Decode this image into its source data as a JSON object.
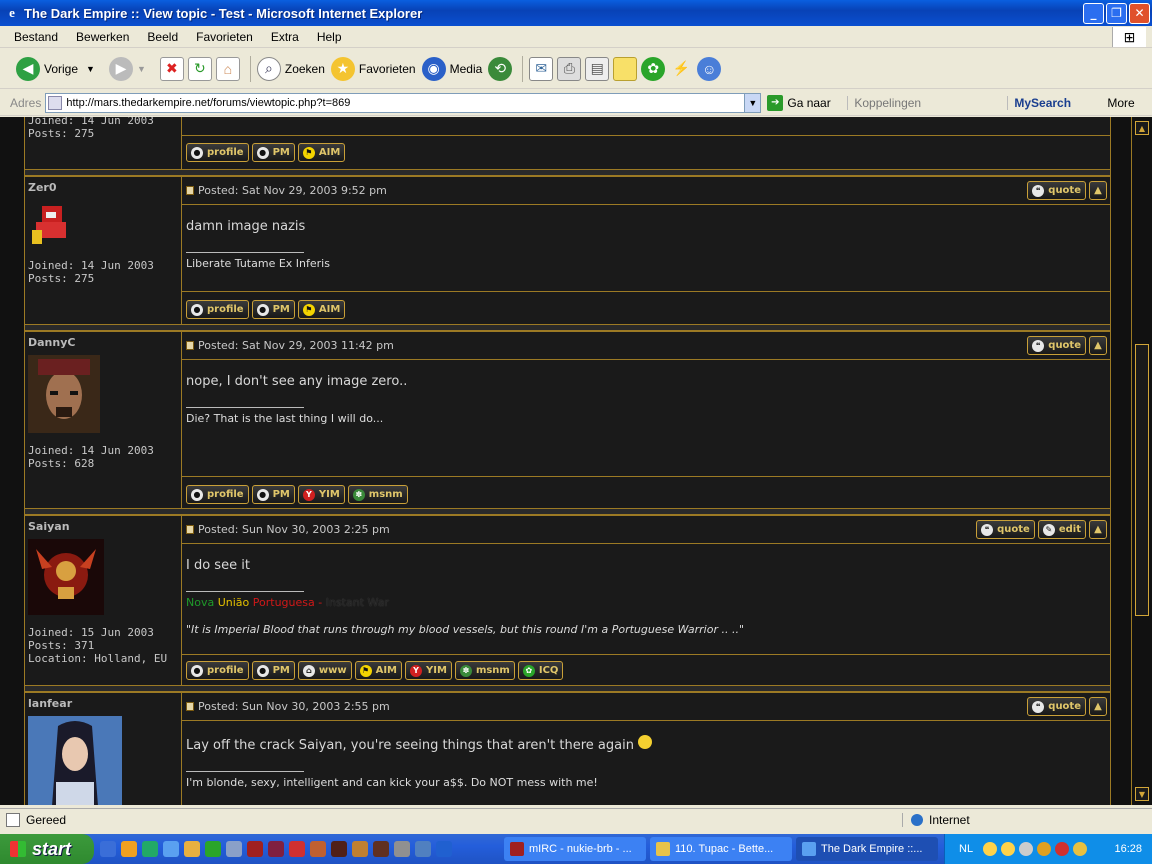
{
  "window": {
    "title": "The Dark Empire :: View topic - Test - Microsoft Internet Explorer"
  },
  "menu": [
    "Bestand",
    "Bewerken",
    "Beeld",
    "Favorieten",
    "Extra",
    "Help"
  ],
  "toolbar": {
    "back": "Vorige",
    "search": "Zoeken",
    "favorites": "Favorieten",
    "media": "Media"
  },
  "address": {
    "label": "Adres",
    "url": "http://mars.thedarkempire.net/forums/viewtopic.php?t=869",
    "go": "Ga naar",
    "links": "Koppelingen",
    "mysearch": "MySearch",
    "more": "More"
  },
  "top_partial": {
    "joined": "Joined: 14 Jun 2003",
    "posts": "Posts: 275"
  },
  "buttons": {
    "profile": "profile",
    "pm": "PM",
    "aim": "AIM",
    "yim": "YIM",
    "msnm": "msnm",
    "www": "www",
    "icq": "ICQ",
    "quote": "quote",
    "edit": "edit"
  },
  "posts": [
    {
      "author": "Zer0",
      "joined": "Joined: 14 Jun 2003",
      "count": "Posts: 275",
      "location": "",
      "posted": "Posted: Sat Nov 29, 2003 9:52 pm",
      "message": "damn image nazis",
      "signature": "Liberate Tutame Ex Inferis"
    },
    {
      "author": "DannyC",
      "joined": "Joined: 14 Jun 2003",
      "count": "Posts: 628",
      "location": "",
      "posted": "Posted: Sat Nov 29, 2003 11:42 pm",
      "message": "nope, I don't see any image zero..",
      "signature": "Die? That is the last thing I will do..."
    },
    {
      "author": "Saiyan",
      "joined": "Joined: 15 Jun 2003",
      "count": "Posts: 371",
      "location": "Location: Holland, EU",
      "posted": "Posted: Sun Nov 30, 2003 2:25 pm",
      "message": "I do see it",
      "sig_nova": "Nova",
      "sig_uniao": "União",
      "sig_portuguesa": "Portuguesa",
      "sig_dash": " - ",
      "sig_war": "Instant War",
      "sig_quote": "\"It is Imperial Blood that runs through my blood vessels, but this round I'm a Portuguese Warrior .. ..\""
    },
    {
      "author": "lanfear",
      "joined": "",
      "count": "",
      "location": "",
      "posted": "Posted: Sun Nov 30, 2003 2:55 pm",
      "message": "Lay off the crack Saiyan, you're seeing things that aren't there again",
      "signature": "I'm blonde, sexy, intelligent and can kick your a$$. Do NOT mess with me!"
    }
  ],
  "status": {
    "text": "Gereed",
    "zone": "Internet"
  },
  "taskbar": {
    "start": "start",
    "tasks": [
      "mIRC - nukie-brb - ...",
      "110. Tupac - Bette...",
      "The Dark Empire ::..."
    ],
    "lang": "NL",
    "clock": "16:28"
  },
  "colors": {
    "accent": "#c9a038",
    "nova": "#1f9a2a",
    "uniao": "#e4c000",
    "portuguesa": "#d01818"
  }
}
